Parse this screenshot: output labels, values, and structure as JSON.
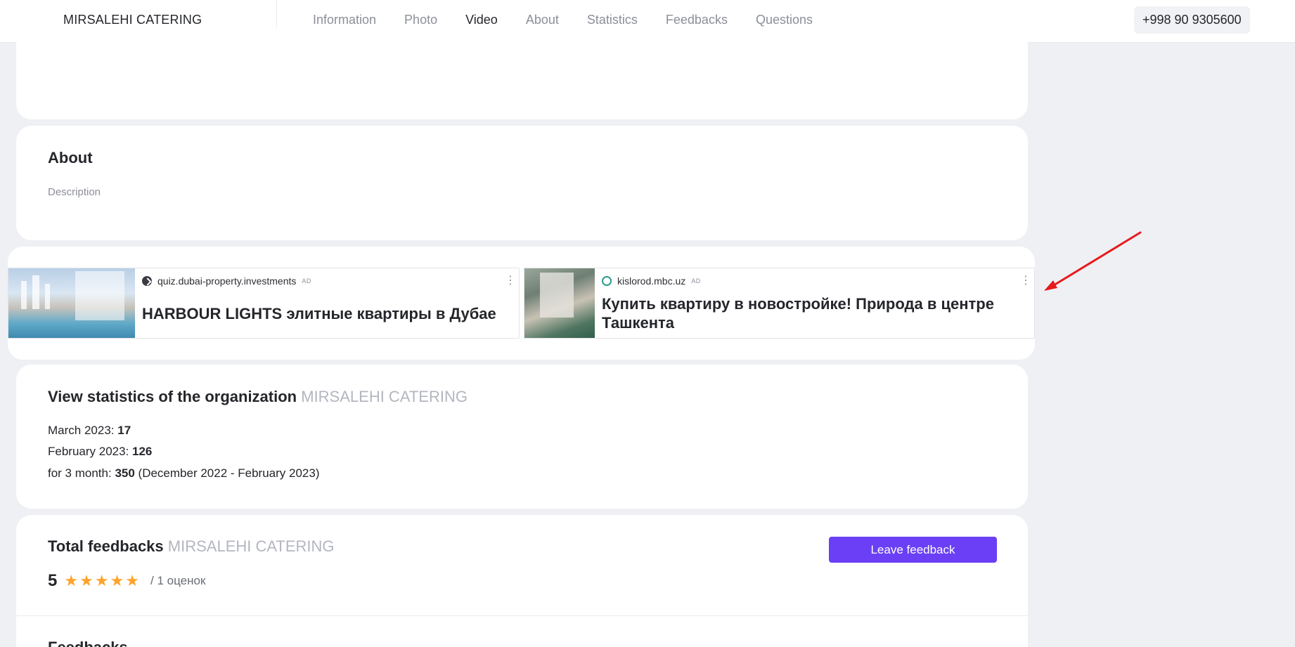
{
  "header": {
    "brand": "MIRSALEHI CATERING",
    "nav": [
      "Information",
      "Photo",
      "Video",
      "About",
      "Statistics",
      "Feedbacks",
      "Questions"
    ],
    "active_nav": "Video",
    "phone": "+998 90 9305600"
  },
  "about": {
    "title": "About",
    "description": "Description"
  },
  "ads": [
    {
      "source": "quiz.dubai-property.investments",
      "badge": "AD",
      "title": "HARBOUR LIGHTS элитные квартиры в Дубае",
      "menu": "⋮"
    },
    {
      "source": "kislorod.mbc.uz",
      "badge": "AD",
      "title": "Купить квартиру в новостройке! Природа в центре Ташкента",
      "menu": "⋮"
    }
  ],
  "stats": {
    "title": "View statistics of the organization",
    "org": "MIRSALEHI CATERING",
    "lines": [
      {
        "label": "March 2023: ",
        "value": "17",
        "suffix": ""
      },
      {
        "label": "February 2023: ",
        "value": "126",
        "suffix": ""
      },
      {
        "label": "for 3 month: ",
        "value": "350",
        "suffix": " (December 2022 - February 2023)"
      }
    ]
  },
  "feedback": {
    "title": "Total feedbacks",
    "org": "MIRSALEHI CATERING",
    "button": "Leave feedback",
    "rating": "5",
    "stars": 5,
    "count_text": "/ 1 оценок",
    "section_title": "Feedbacks"
  },
  "colors": {
    "accent": "#6b3ff5",
    "star": "#ffa32b",
    "arrow": "#e8191c"
  }
}
